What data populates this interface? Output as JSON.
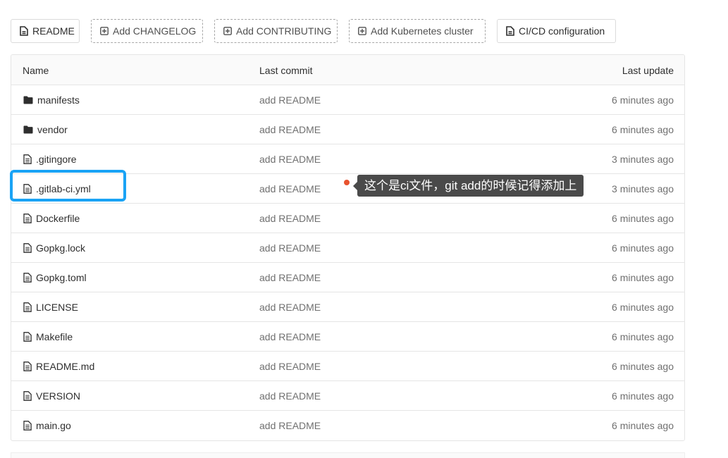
{
  "toolbar": {
    "buttons": [
      {
        "label": "README",
        "style": "solid",
        "icon": "file-icon"
      },
      {
        "label": "Add CHANGELOG",
        "style": "dashed",
        "icon": "plus-square-icon"
      },
      {
        "label": "Add CONTRIBUTING",
        "style": "dashed",
        "icon": "plus-square-icon"
      },
      {
        "label": "Add Kubernetes cluster",
        "style": "dashed",
        "icon": "plus-square-icon"
      },
      {
        "label": "CI/CD configuration",
        "style": "solid",
        "icon": "file-icon"
      }
    ]
  },
  "table": {
    "headers": {
      "name": "Name",
      "commit": "Last commit",
      "update": "Last update"
    },
    "rows": [
      {
        "name": "manifests",
        "type": "folder",
        "commit": "add README",
        "update": "6 minutes ago"
      },
      {
        "name": "vendor",
        "type": "folder",
        "commit": "add README",
        "update": "6 minutes ago"
      },
      {
        "name": ".gitingore",
        "type": "file",
        "commit": "add README",
        "update": "3 minutes ago"
      },
      {
        "name": ".gitlab-ci.yml",
        "type": "file",
        "commit": "add README",
        "update": "3 minutes ago"
      },
      {
        "name": "Dockerfile",
        "type": "file",
        "commit": "add README",
        "update": "6 minutes ago"
      },
      {
        "name": "Gopkg.lock",
        "type": "file",
        "commit": "add README",
        "update": "6 minutes ago"
      },
      {
        "name": "Gopkg.toml",
        "type": "file",
        "commit": "add README",
        "update": "6 minutes ago"
      },
      {
        "name": "LICENSE",
        "type": "file",
        "commit": "add README",
        "update": "6 minutes ago"
      },
      {
        "name": "Makefile",
        "type": "file",
        "commit": "add README",
        "update": "6 minutes ago"
      },
      {
        "name": "README.md",
        "type": "file",
        "commit": "add README",
        "update": "6 minutes ago"
      },
      {
        "name": "VERSION",
        "type": "file",
        "commit": "add README",
        "update": "6 minutes ago"
      },
      {
        "name": "main.go",
        "type": "file",
        "commit": "add README",
        "update": "6 minutes ago"
      }
    ]
  },
  "annotation": {
    "text": "这个是ci文件，git add的时候记得添加上",
    "highlight_color": "#1aa3f5",
    "dot_color": "#e8532f"
  }
}
